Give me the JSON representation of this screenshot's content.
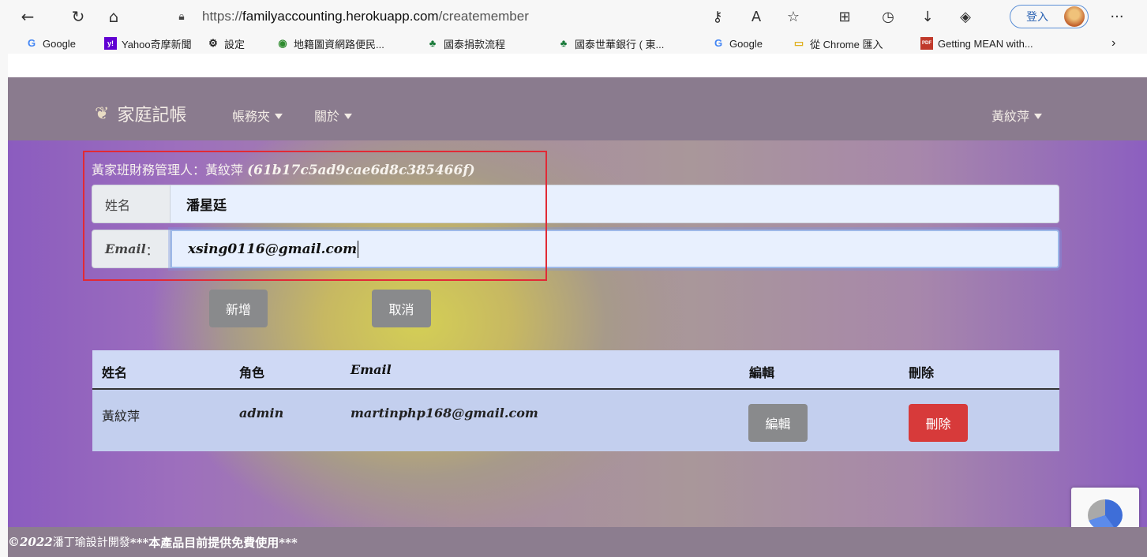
{
  "browser": {
    "url_prefix": "https://",
    "url_host": "familyaccounting.herokuapp.com",
    "url_path": "/createmember",
    "login_label": "登入",
    "bookmarks": [
      {
        "label": "Google",
        "icon": "G"
      },
      {
        "label": "Yahoo奇摩新聞",
        "icon": "y!"
      },
      {
        "label": "設定",
        "icon": "⚙"
      },
      {
        "label": "地籍圖資網路便民...",
        "icon": "◉"
      },
      {
        "label": "國泰捐款流程",
        "icon": "♣"
      },
      {
        "label": "國泰世華銀行 ( 東...",
        "icon": "♣"
      },
      {
        "label": "Google",
        "icon": "G"
      },
      {
        "label": "從 Chrome 匯入",
        "icon": "▭"
      },
      {
        "label": "Getting MEAN with...",
        "icon": "PDF"
      }
    ]
  },
  "navbar": {
    "brand": "家庭記帳",
    "menu_ledger": "帳務夾",
    "menu_about": "關於",
    "user": "黃紋萍"
  },
  "form": {
    "owner_label": "黃家班財務管理人：黃紋萍",
    "owner_id": "(61b17c5ad9cae6d8c385466f)",
    "name_label": "姓名",
    "name_value": "潘星廷",
    "email_label": "Email",
    "email_colon": "：",
    "email_value": "xsing0116@gmail.com",
    "add_button": "新增",
    "cancel_button": "取消"
  },
  "table": {
    "headers": [
      "姓名",
      "角色",
      "Email",
      "編輯",
      "刪除"
    ],
    "rows": [
      {
        "name": "黃紋萍",
        "role": "admin",
        "email": "martinphp168@gmail.com",
        "edit": "編輯",
        "delete": "刪除"
      }
    ]
  },
  "footer": {
    "copyright": "©2022",
    "developer": " 潘丁瑜設計開發 ",
    "notice": "***本產品目前提供免費使用***"
  },
  "colors": {
    "delete_button": "#d73a3a",
    "highlight_box": "#e12a36",
    "navbar": "#8a7b8e"
  }
}
